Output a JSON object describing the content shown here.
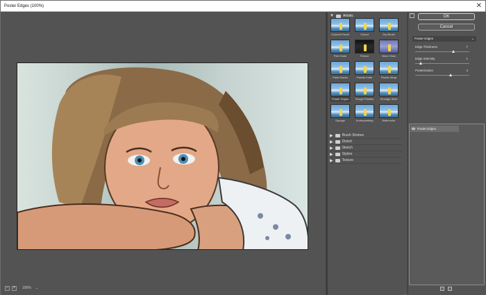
{
  "window": {
    "title": "Poster Edges (100%)"
  },
  "preview": {
    "zoom": "100%"
  },
  "gallery": {
    "open_category": "Artistic",
    "filters": [
      {
        "label": "Colored Pencil",
        "style": "blue",
        "selected": false
      },
      {
        "label": "Cutout",
        "style": "blue",
        "selected": false
      },
      {
        "label": "Dry Brush",
        "style": "blue",
        "selected": false
      },
      {
        "label": "Film Grain",
        "style": "blue",
        "selected": false
      },
      {
        "label": "Fresco",
        "style": "dark",
        "selected": false
      },
      {
        "label": "Neon Glow",
        "style": "violet",
        "selected": false
      },
      {
        "label": "Paint Daubs",
        "style": "blue",
        "selected": false
      },
      {
        "label": "Palette Knife",
        "style": "blue",
        "selected": false
      },
      {
        "label": "Plastic Wrap",
        "style": "blue",
        "selected": false
      },
      {
        "label": "Poster Edges",
        "style": "blue",
        "selected": true
      },
      {
        "label": "Rough Pastels",
        "style": "blue",
        "selected": false
      },
      {
        "label": "Smudge Stick",
        "style": "blue",
        "selected": false
      },
      {
        "label": "Sponge",
        "style": "blue",
        "selected": false
      },
      {
        "label": "Underpainting",
        "style": "blue",
        "selected": false
      },
      {
        "label": "Watercolor",
        "style": "blue",
        "selected": false
      }
    ],
    "categories": [
      "Brush Strokes",
      "Distort",
      "Sketch",
      "Stylize",
      "Texture"
    ]
  },
  "settings": {
    "ok_label": "OK",
    "cancel_label": "Cancel",
    "filter_select": "Poster Edges",
    "params": [
      {
        "label": "Edge Thickness",
        "value": "7",
        "fraction": 0.7
      },
      {
        "label": "Edge Intensity",
        "value": "1",
        "fraction": 0.1
      },
      {
        "label": "Posterization",
        "value": "4",
        "fraction": 0.66
      }
    ]
  },
  "layers": {
    "items": [
      "Poster Edges"
    ]
  }
}
